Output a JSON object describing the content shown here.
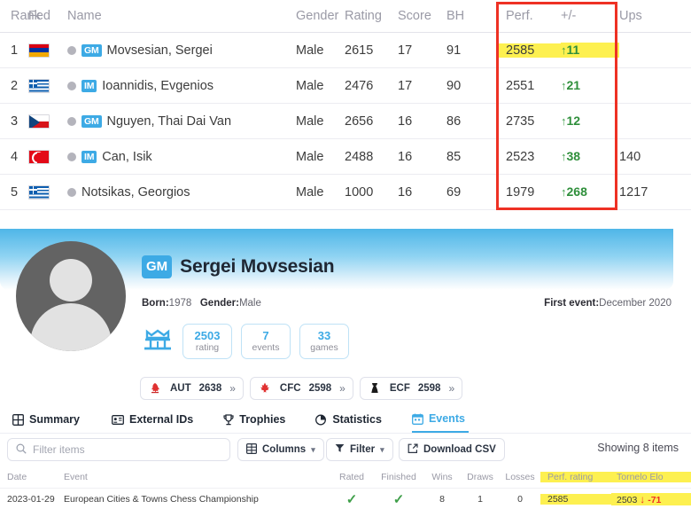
{
  "standings": {
    "columns": [
      "Rank",
      "Fed",
      "Name",
      "Gender",
      "Rating",
      "Score",
      "BH",
      "Perf.",
      "+/-",
      "Ups"
    ],
    "rows": [
      {
        "rank": "1",
        "flag": "flag-am",
        "flag_name": "flag-armenia",
        "dot": true,
        "title": "GM",
        "name": "Movsesian, Sergei",
        "gender": "Male",
        "rating": "2615",
        "score": "17",
        "bh": "91",
        "perf": "2585",
        "pm": "11",
        "pm_dir": "↑",
        "ups": "",
        "highlight": true
      },
      {
        "rank": "2",
        "flag": "flag-gr",
        "flag_name": "flag-greece",
        "dot": true,
        "title": "IM",
        "name": "Ioannidis, Evgenios",
        "gender": "Male",
        "rating": "2476",
        "score": "17",
        "bh": "90",
        "perf": "2551",
        "pm": "21",
        "pm_dir": "↑",
        "ups": "",
        "highlight": false
      },
      {
        "rank": "3",
        "flag": "flag-cz",
        "flag_name": "flag-czechia",
        "dot": true,
        "title": "GM",
        "name": "Nguyen, Thai Dai Van",
        "gender": "Male",
        "rating": "2656",
        "score": "16",
        "bh": "86",
        "perf": "2735",
        "pm": "12",
        "pm_dir": "↑",
        "ups": "",
        "highlight": false
      },
      {
        "rank": "4",
        "flag": "flag-tr",
        "flag_name": "flag-turkey",
        "dot": true,
        "title": "IM",
        "name": "Can, Isik",
        "gender": "Male",
        "rating": "2488",
        "score": "16",
        "bh": "85",
        "perf": "2523",
        "pm": "38",
        "pm_dir": "↑",
        "ups": "140",
        "highlight": false
      },
      {
        "rank": "5",
        "flag": "flag-gr",
        "flag_name": "flag-greece",
        "dot": true,
        "title": "",
        "name": "Notsikas, Georgios",
        "gender": "Male",
        "rating": "1000",
        "score": "16",
        "bh": "69",
        "perf": "1979",
        "pm": "268",
        "pm_dir": "↑",
        "ups": "1217",
        "highlight": false
      }
    ],
    "highlight_color": "#fdf050",
    "annotation_box_color": "#ee3124"
  },
  "profile": {
    "title_badge": "GM",
    "name": "Sergei Movsesian",
    "born_label": "Born:",
    "born_value": "1978",
    "gender_label": "Gender:",
    "gender_value": "Male",
    "first_event_label": "First event:",
    "first_event_value": "December 2020",
    "stats": [
      {
        "value": "2503",
        "label": "rating"
      },
      {
        "value": "7",
        "label": "events"
      },
      {
        "value": "33",
        "label": "games"
      }
    ],
    "federations": [
      {
        "icon": "fed-aut-icon",
        "code": "AUT",
        "value": "2638",
        "chevron": "»"
      },
      {
        "icon": "fed-cfc-icon",
        "code": "CFC",
        "value": "2598",
        "chevron": "»"
      },
      {
        "icon": "fed-ecf-icon",
        "code": "ECF",
        "value": "2598",
        "chevron": "»"
      }
    ],
    "accent_color": "#3daae5"
  },
  "tabs": [
    {
      "label": "Summary",
      "icon": "grid-icon",
      "active": false
    },
    {
      "label": "External IDs",
      "icon": "id-card-icon",
      "active": false
    },
    {
      "label": "Trophies",
      "icon": "trophy-icon",
      "active": false
    },
    {
      "label": "Statistics",
      "icon": "pie-chart-icon",
      "active": false
    },
    {
      "label": "Events",
      "icon": "calendar-icon",
      "active": true
    }
  ],
  "toolbar": {
    "filter_placeholder": "Filter items",
    "columns_label": "Columns",
    "filter_label": "Filter",
    "download_label": "Download CSV",
    "showing": "Showing 8 items"
  },
  "events_table": {
    "columns": [
      "Date",
      "Event",
      "Rated",
      "Finished",
      "Wins",
      "Draws",
      "Losses",
      "Perf. rating",
      "Tornelo Elo"
    ],
    "rows": [
      {
        "date": "2023-01-29",
        "event": "European Cities & Towns Chess Championship",
        "rated": "✓",
        "finished": "✓",
        "wins": "8",
        "draws": "1",
        "losses": "0",
        "perf_rating": "2585",
        "elo": "2503",
        "elo_delta": "-71",
        "elo_dir": "↓"
      }
    ],
    "highlight_color": "#fdf050"
  }
}
